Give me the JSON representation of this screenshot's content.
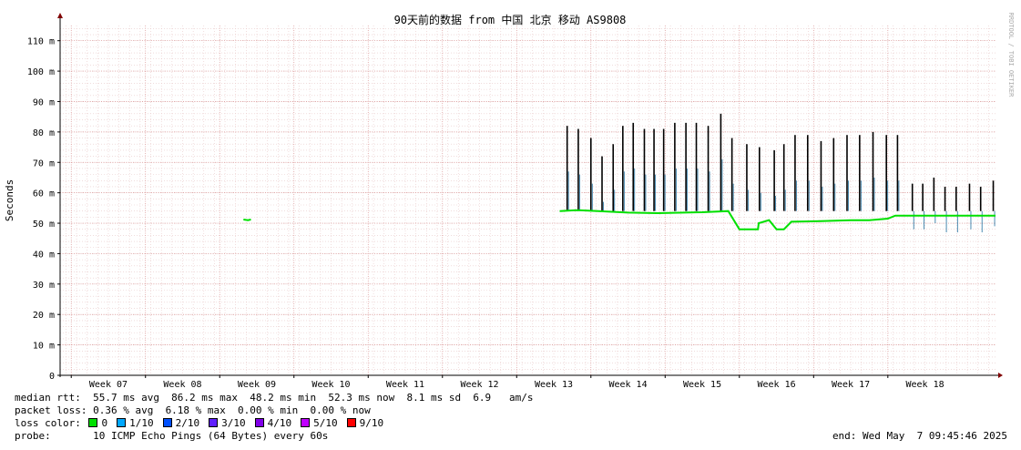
{
  "chart_data": {
    "type": "line",
    "title": "90天前的数据 from 中国 北京 移动 AS9808",
    "ylabel": "Seconds",
    "watermark": "RRDTOOL / TOBI OETIKER",
    "ylim": [
      0,
      115
    ],
    "yticks": [
      0,
      10,
      20,
      30,
      40,
      50,
      60,
      70,
      80,
      90,
      100,
      110
    ],
    "ytick_labels": [
      "0",
      "10 m",
      "20 m",
      "30 m",
      "40 m",
      "50 m",
      "60 m",
      "70 m",
      "80 m",
      "90 m",
      "100 m",
      "110 m"
    ],
    "xlim": [
      6.35,
      18.95
    ],
    "xticks": [
      7,
      8,
      9,
      10,
      11,
      12,
      13,
      14,
      15,
      16,
      17,
      18
    ],
    "xtick_labels": [
      "Week 07",
      "Week 08",
      "Week 09",
      "Week 10",
      "Week 11",
      "Week 12",
      "Week 13",
      "Week 14",
      "Week 15",
      "Week 16",
      "Week 17",
      "Week 18"
    ],
    "grid": true,
    "series": [
      {
        "role": "median",
        "segments": [
          [
            [
              8.82,
              51.2
            ],
            [
              8.88,
              51.0
            ],
            [
              8.92,
              51.2
            ]
          ],
          [
            [
              13.08,
              54
            ],
            [
              13.3,
              54.3
            ],
            [
              13.6,
              54
            ],
            [
              14.0,
              53.5
            ],
            [
              14.4,
              53.3
            ],
            [
              15.0,
              53.6
            ],
            [
              15.35,
              54
            ],
            [
              15.5,
              48
            ],
            [
              15.75,
              48
            ],
            [
              15.76,
              50
            ],
            [
              15.9,
              51
            ],
            [
              16.0,
              48
            ],
            [
              16.1,
              48
            ],
            [
              16.2,
              50.5
            ],
            [
              16.6,
              50.7
            ],
            [
              17.0,
              51
            ],
            [
              17.25,
              51
            ],
            [
              17.5,
              51.5
            ],
            [
              17.6,
              52.5
            ],
            [
              18.2,
              52.5
            ],
            [
              18.95,
              52.5
            ]
          ]
        ]
      }
    ],
    "spikes": {
      "description_values_ms": true,
      "peaks": [
        [
          13.18,
          82
        ],
        [
          13.33,
          81
        ],
        [
          13.5,
          78
        ],
        [
          13.65,
          72
        ],
        [
          13.8,
          76
        ],
        [
          13.93,
          82
        ],
        [
          14.07,
          83
        ],
        [
          14.22,
          81
        ],
        [
          14.35,
          81
        ],
        [
          14.48,
          81
        ],
        [
          14.63,
          83
        ],
        [
          14.78,
          83
        ],
        [
          14.92,
          83
        ],
        [
          15.08,
          82
        ],
        [
          15.25,
          86
        ],
        [
          15.4,
          78
        ],
        [
          15.6,
          76
        ],
        [
          15.77,
          75
        ],
        [
          15.97,
          74
        ],
        [
          16.1,
          76
        ],
        [
          16.25,
          79
        ],
        [
          16.42,
          79
        ],
        [
          16.6,
          77
        ],
        [
          16.77,
          78
        ],
        [
          16.95,
          79
        ],
        [
          17.12,
          79
        ],
        [
          17.3,
          80
        ],
        [
          17.48,
          79
        ],
        [
          17.63,
          79
        ],
        [
          17.83,
          63
        ],
        [
          17.97,
          63
        ],
        [
          18.12,
          65
        ],
        [
          18.27,
          62
        ],
        [
          18.42,
          62
        ],
        [
          18.6,
          63
        ],
        [
          18.75,
          62
        ],
        [
          18.92,
          64
        ]
      ]
    },
    "loss_colors": [
      "#00e000",
      "#00a8ff",
      "#0050ff",
      "#6020ff",
      "#8000e8",
      "#c000ff",
      "#ff0000"
    ]
  },
  "stats": {
    "rtt_line": "median rtt:  55.7 ms avg  86.2 ms max  48.2 ms min  52.3 ms now  8.1 ms sd  6.9   am/s",
    "loss_line": "packet loss: 0.36 % avg  6.18 % max  0.00 % min  0.00 % now",
    "loss_label": "loss color:",
    "loss_items": [
      "0",
      "1/10",
      "2/10",
      "3/10",
      "4/10",
      "5/10",
      "9/10"
    ],
    "probe_line": "probe:       10 ICMP Echo Pings (64 Bytes) every 60s",
    "end_line": "end: Wed May  7 09:45:46 2025"
  }
}
